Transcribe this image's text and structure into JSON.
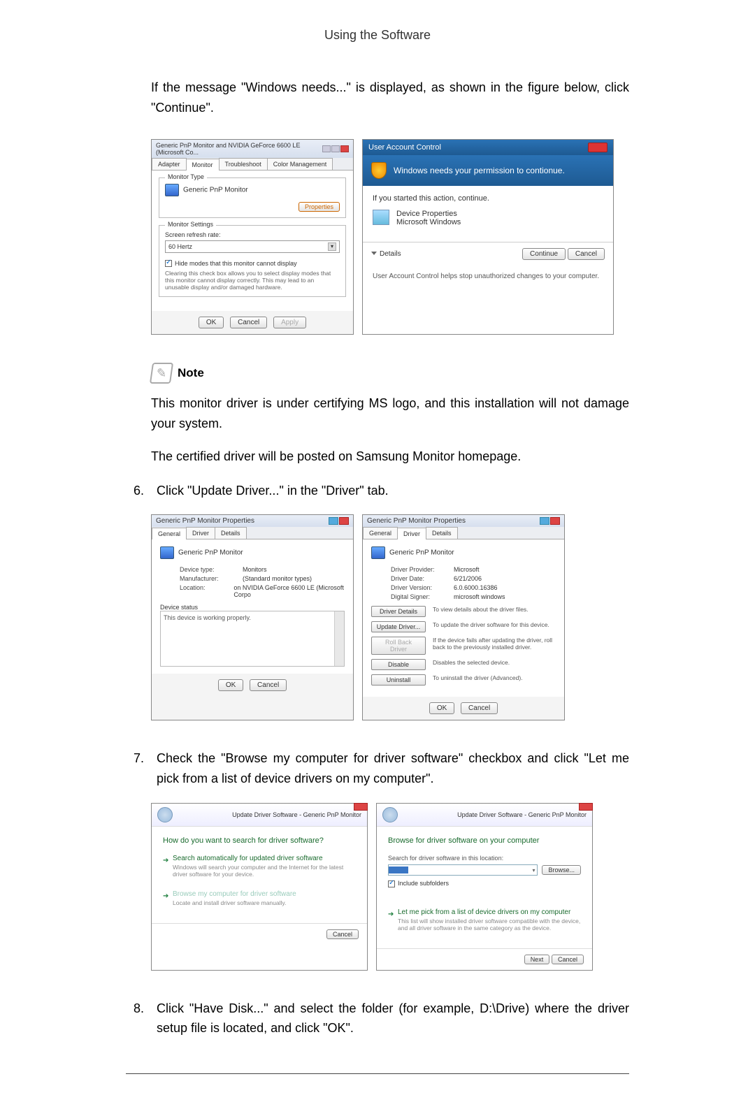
{
  "header": {
    "title": "Using the Software"
  },
  "intro": "If the message \"Windows needs...\" is displayed, as shown in the figure below, click \"Continue\".",
  "dialog1": {
    "title": "Generic PnP Monitor and NVIDIA GeForce 6600 LE (Microsoft Co...",
    "tabs": [
      "Adapter",
      "Monitor",
      "Troubleshoot",
      "Color Management"
    ],
    "monitor_type_label": "Monitor Type",
    "monitor_name": "Generic PnP Monitor",
    "properties_btn": "Properties",
    "monitor_settings_label": "Monitor Settings",
    "refresh_label": "Screen refresh rate:",
    "refresh_value": "60 Hertz",
    "hide_modes": "Hide modes that this monitor cannot display",
    "hide_modes_desc": "Clearing this check box allows you to select display modes that this monitor cannot display correctly. This may lead to an unusable display and/or damaged hardware.",
    "ok": "OK",
    "cancel": "Cancel",
    "apply": "Apply"
  },
  "dialog2": {
    "title": "User Account Control",
    "banner": "Windows needs your permission to contionue.",
    "if_started": "If you started this action, continue.",
    "program": "Device Properties",
    "publisher": "Microsoft Windows",
    "details": "Details",
    "continue": "Continue",
    "cancel": "Cancel",
    "footer": "User Account Control helps stop unauthorized changes to your computer."
  },
  "note": {
    "label": "Note",
    "p1": "This monitor driver is under certifying MS logo, and this installation will not damage your system.",
    "p2": "The certified driver will be posted on Samsung Monitor homepage."
  },
  "step6": {
    "num": "6.",
    "text": "Click \"Update Driver...\" in the \"Driver\" tab."
  },
  "dialog3": {
    "title": "Generic PnP Monitor Properties",
    "tabs": [
      "General",
      "Driver",
      "Details"
    ],
    "monitor_name": "Generic PnP Monitor",
    "device_type_k": "Device type:",
    "device_type_v": "Monitors",
    "manu_k": "Manufacturer:",
    "manu_v": "(Standard monitor types)",
    "loc_k": "Location:",
    "loc_v": "on NVIDIA GeForce 6600 LE (Microsoft Corpo",
    "status_label": "Device status",
    "status_text": "This device is working properly.",
    "ok": "OK",
    "cancel": "Cancel"
  },
  "dialog4": {
    "title": "Generic PnP Monitor Properties",
    "tabs": [
      "General",
      "Driver",
      "Details"
    ],
    "monitor_name": "Generic PnP Monitor",
    "provider_k": "Driver Provider:",
    "provider_v": "Microsoft",
    "date_k": "Driver Date:",
    "date_v": "6/21/2006",
    "ver_k": "Driver Version:",
    "ver_v": "6.0.6000.16386",
    "signer_k": "Digital Signer:",
    "signer_v": "microsoft windows",
    "btn_details": "Driver Details",
    "desc_details": "To view details about the driver files.",
    "btn_update": "Update Driver...",
    "desc_update": "To update the driver software for this device.",
    "btn_rollback": "Roll Back Driver",
    "desc_rollback": "If the device fails after updating the driver, roll back to the previously installed driver.",
    "btn_disable": "Disable",
    "desc_disable": "Disables the selected device.",
    "btn_uninstall": "Uninstall",
    "desc_uninstall": "To uninstall the driver (Advanced).",
    "ok": "OK",
    "cancel": "Cancel"
  },
  "step7": {
    "num": "7.",
    "text": "Check the \"Browse my computer for driver software\" checkbox and click \"Let me pick from a list of device drivers on my computer\"."
  },
  "dialog5": {
    "crumb": "Update Driver Software - Generic PnP Monitor",
    "heading": "How do you want to search for driver software?",
    "opt1_title": "Search automatically for updated driver software",
    "opt1_desc": "Windows will search your computer and the Internet for the latest driver software for your device.",
    "opt2_title": "Browse my computer for driver software",
    "opt2_desc": "Locate and install driver software manually.",
    "cancel": "Cancel"
  },
  "dialog6": {
    "crumb": "Update Driver Software - Generic PnP Monitor",
    "heading": "Browse for driver software on your computer",
    "search_label": "Search for driver software in this location:",
    "browse": "Browse...",
    "include_sub": "Include subfolders",
    "opt_title": "Let me pick from a list of device drivers on my computer",
    "opt_desc": "This list will show installed driver software compatible with the device, and all driver software in the same category as the device.",
    "next": "Next",
    "cancel": "Cancel"
  },
  "step8": {
    "num": "8.",
    "text": "Click \"Have Disk...\" and select the folder (for example, D:\\Drive) where the driver setup file is located, and click \"OK\"."
  }
}
